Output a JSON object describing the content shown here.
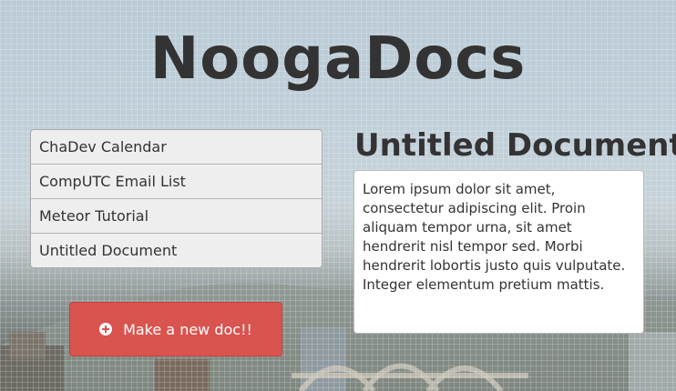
{
  "app": {
    "title": "NoogaDocs"
  },
  "documents": [
    {
      "label": "ChaDev Calendar"
    },
    {
      "label": "CompUTC Email List"
    },
    {
      "label": "Meteor Tutorial"
    },
    {
      "label": "Untitled Document"
    }
  ],
  "new_doc_button": {
    "label": "Make a new doc!!",
    "icon": "plus-circle-icon",
    "color": "#d9534f"
  },
  "editor": {
    "title": "Untitled Document",
    "body": "Lorem ipsum dolor sit amet, consectetur adipiscing elit. Proin aliquam tempor urna, sit amet hendrerit nisl tempor sed. Morbi hendrerit lobortis justo quis vulputate. Integer elementum pretium mattis."
  }
}
